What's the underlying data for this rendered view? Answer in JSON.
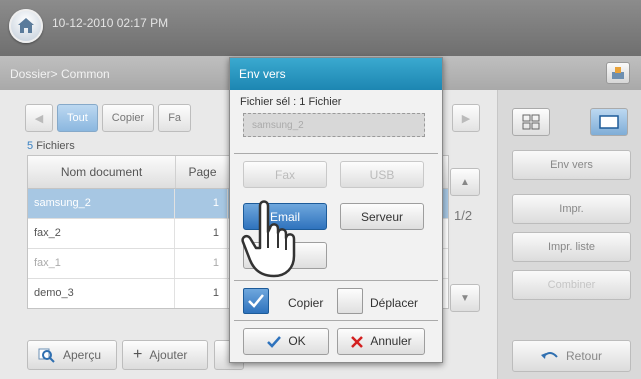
{
  "header": {
    "datetime": "10-12-2010 02:17 PM"
  },
  "breadcrumb": {
    "path": "Dossier> Common"
  },
  "tabs": [
    {
      "label": "Tout",
      "active": true
    },
    {
      "label": "Copier",
      "active": false
    },
    {
      "label": "Fa",
      "active": false
    }
  ],
  "file_count": {
    "number": "5",
    "label": "Fichiers"
  },
  "page_partial": "2",
  "table": {
    "headers": [
      "Nom document",
      "Page"
    ],
    "rows": [
      {
        "name": "samsung_2",
        "page": "1"
      },
      {
        "name": "fax_2",
        "page": "1"
      },
      {
        "name": "fax_1",
        "page": "1"
      },
      {
        "name": "demo_3",
        "page": "1"
      }
    ]
  },
  "pagination": "1/2",
  "bottom": {
    "preview": "Aperçu",
    "add": "Ajouter"
  },
  "right_panel": {
    "send": "Env vers",
    "print": "Impr.",
    "print_list": "Impr. liste",
    "combine": "Combiner",
    "back": "Retour"
  },
  "dialog": {
    "title": "Env vers",
    "selected_label": "Fichier sél : 1 Fichier",
    "selected_file": "samsung_2",
    "buttons": {
      "fax": "Fax",
      "usb": "USB",
      "email": "Email",
      "server": "Serveur"
    },
    "copy_label": "Copier",
    "move_label": "Déplacer",
    "ok": "OK",
    "cancel": "Annuler"
  },
  "colors": {
    "accent": "#2f73bd",
    "title_bar": "#1d86b2",
    "selected_row": "#a7c7e3",
    "cancel_x": "#d32020"
  }
}
